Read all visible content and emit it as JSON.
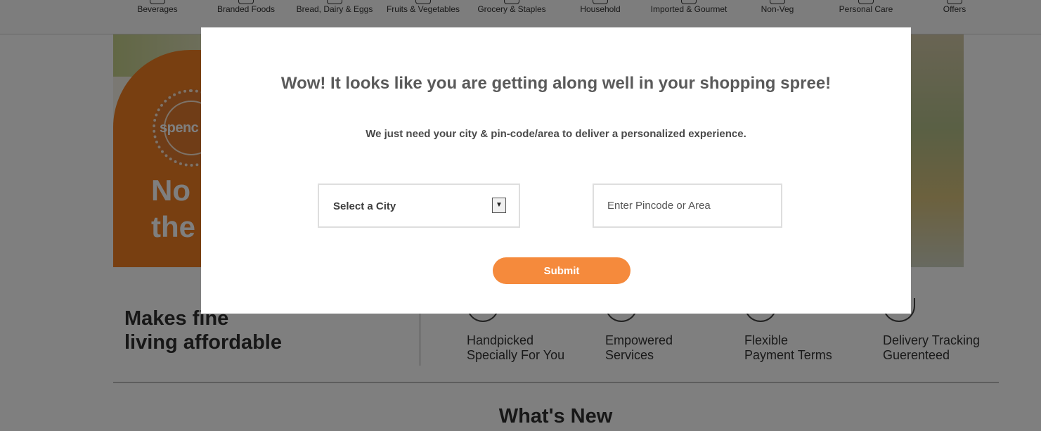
{
  "categories": [
    {
      "label": "Beverages",
      "icon": "beverages-icon"
    },
    {
      "label": "Branded Foods",
      "icon": "branded-foods-icon"
    },
    {
      "label": "Bread, Dairy & Eggs",
      "icon": "bread-dairy-icon"
    },
    {
      "label": "Fruits & Vegetables",
      "icon": "fruits-vegetables-icon"
    },
    {
      "label": "Grocery & Staples",
      "icon": "grocery-icon"
    },
    {
      "label": "Household",
      "icon": "household-icon"
    },
    {
      "label": "Imported & Gourmet",
      "icon": "imported-gourmet-icon"
    },
    {
      "label": "Non-Veg",
      "icon": "non-veg-icon"
    },
    {
      "label": "Personal Care",
      "icon": "personal-care-icon"
    },
    {
      "label": "Offers",
      "icon": "offers-icon"
    }
  ],
  "banner": {
    "seal_text": "spenc",
    "headline_line1": "No",
    "headline_line2": "the"
  },
  "tagline": {
    "line1": "Makes fine",
    "line2": "living affordable"
  },
  "features": [
    {
      "line1": "Handpicked",
      "line2": "Specially For You"
    },
    {
      "line1": "Empowered",
      "line2": "Services"
    },
    {
      "line1": "Flexible",
      "line2": "Payment Terms"
    },
    {
      "line1": "Delivery Tracking",
      "line2": "Guerenteed"
    }
  ],
  "section": {
    "whats_new": "What's New"
  },
  "modal": {
    "title": "Wow! It looks like you are getting along well in your shopping spree!",
    "subtitle": "We just need your city & pin-code/area to deliver a personalized experience.",
    "city_select_value": "Select a City",
    "pincode_placeholder": "Enter Pincode or Area",
    "submit_label": "Submit"
  },
  "colors": {
    "accent": "#f58a3c",
    "banner_orange": "#f07e22",
    "overlay": "rgba(0,0,0,0.5)"
  }
}
